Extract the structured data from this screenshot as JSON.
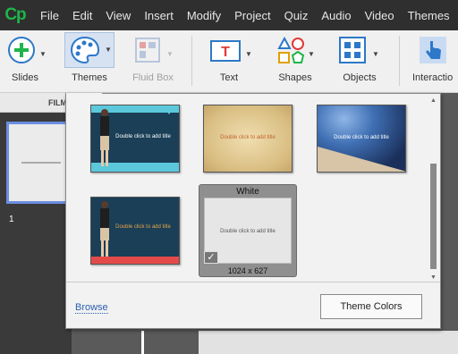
{
  "app": {
    "logo_text": "Cp"
  },
  "menu": [
    "File",
    "Edit",
    "View",
    "Insert",
    "Modify",
    "Project",
    "Quiz",
    "Audio",
    "Video",
    "Themes"
  ],
  "toolbar": {
    "slides": "Slides",
    "themes": "Themes",
    "fluid_box": "Fluid Box",
    "text": "Text",
    "shapes": "Shapes",
    "objects": "Objects",
    "interactions": "Interactio"
  },
  "filmstrip": {
    "header": "FILM",
    "slide_number": "1"
  },
  "themes_panel": {
    "themes": [
      {
        "title": "Double click to add title"
      },
      {
        "title": "Double click to add title"
      },
      {
        "title": "Double click to add title"
      },
      {
        "title": "Double click to add title"
      },
      {
        "title": "Double click to add title"
      }
    ],
    "selected_name": "White",
    "selected_size": "1024 x 627",
    "browse_label": "Browse",
    "theme_colors_label": "Theme Colors"
  },
  "colors": {
    "accent_green": "#1fb54a",
    "selection_blue": "#6b8ee0",
    "link_blue": "#2a5fb3"
  }
}
